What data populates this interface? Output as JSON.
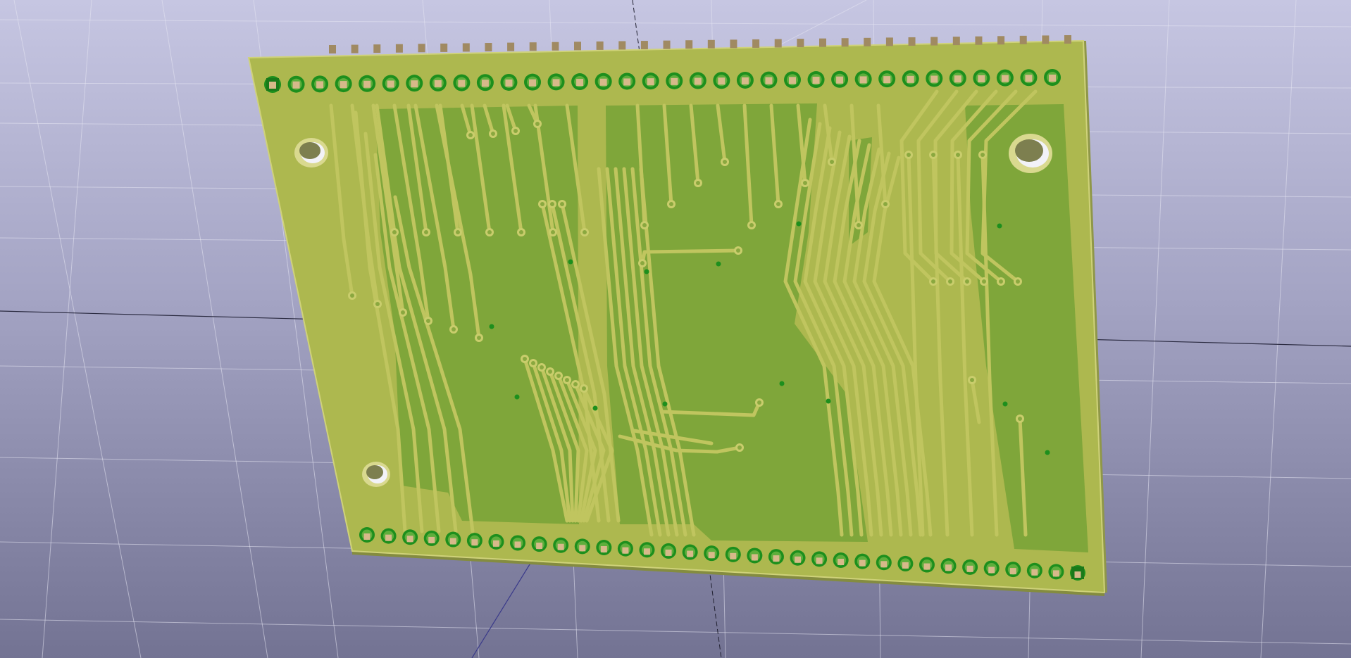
{
  "viewer": {
    "view_mode": "3D PCB viewer",
    "background_top": "#c6c6e2",
    "background_bottom": "#737393",
    "grid_color": "#ffffff",
    "axis_color": "#1a1a2e"
  },
  "board": {
    "surface_color": "#adb84f",
    "edge_color": "#cfd27a",
    "copper_zone_color": "#7fa63a",
    "track_color": "#c0c55f",
    "pad_color": "#1a8a1a",
    "pin_color": "#a08a62",
    "top_header_pins": 34,
    "bottom_header_pins": 34,
    "mounting_holes": 3
  }
}
